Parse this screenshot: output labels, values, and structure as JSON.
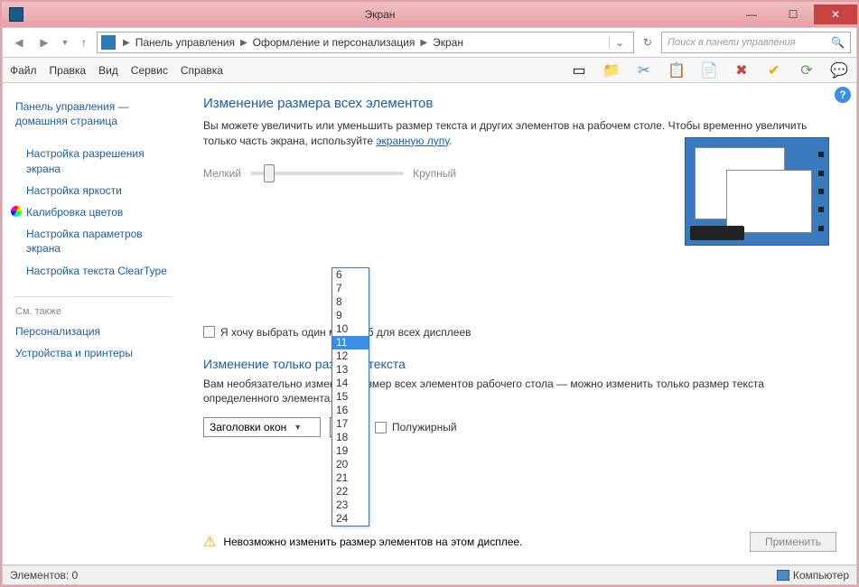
{
  "title": "Экран",
  "breadcrumb": {
    "items": [
      "Панель управления",
      "Оформление и персонализация",
      "Экран"
    ]
  },
  "search": {
    "placeholder": "Поиск в панели управления"
  },
  "menu": {
    "file": "Файл",
    "edit": "Правка",
    "view": "Вид",
    "service": "Сервис",
    "help": "Справка"
  },
  "sidebar": {
    "home1": "Панель управления —",
    "home2": "домашняя страница",
    "links": [
      "Настройка разрешения экрана",
      "Настройка яркости",
      "Калибровка цветов",
      "Настройка параметров экрана",
      "Настройка текста ClearType"
    ],
    "see_also": "См. также",
    "extra": [
      "Персонализация",
      "Устройства и принтеры"
    ]
  },
  "main": {
    "heading1": "Изменение размера всех элементов",
    "desc1a": "Вы можете увеличить или уменьшить размер текста и других элементов на рабочем столе. Чтобы временно увеличить только часть экрана, используйте ",
    "desc1_link": "экранную лупу",
    "slider_min": "Мелкий",
    "slider_max": "Крупный",
    "check_label": "Я хочу выбрать один масштаб для всех дисплеев",
    "heading2": "Изменение только размера текста",
    "desc2": "Вам необязательно изменять размер всех элементов рабочего стола — можно изменить только размер текста определенного элемента.",
    "select1": "Заголовки окон",
    "select2": "11",
    "bold_label": "Полужирный",
    "warning": "Невозможно изменить размер элементов на этом дисплее.",
    "apply": "Применить"
  },
  "dropdown": {
    "options": [
      "6",
      "7",
      "8",
      "9",
      "10",
      "11",
      "12",
      "13",
      "14",
      "15",
      "16",
      "17",
      "18",
      "19",
      "20",
      "21",
      "22",
      "23",
      "24"
    ],
    "selected": "11"
  },
  "status": {
    "left": "Элементов: 0",
    "right": "Компьютер"
  }
}
